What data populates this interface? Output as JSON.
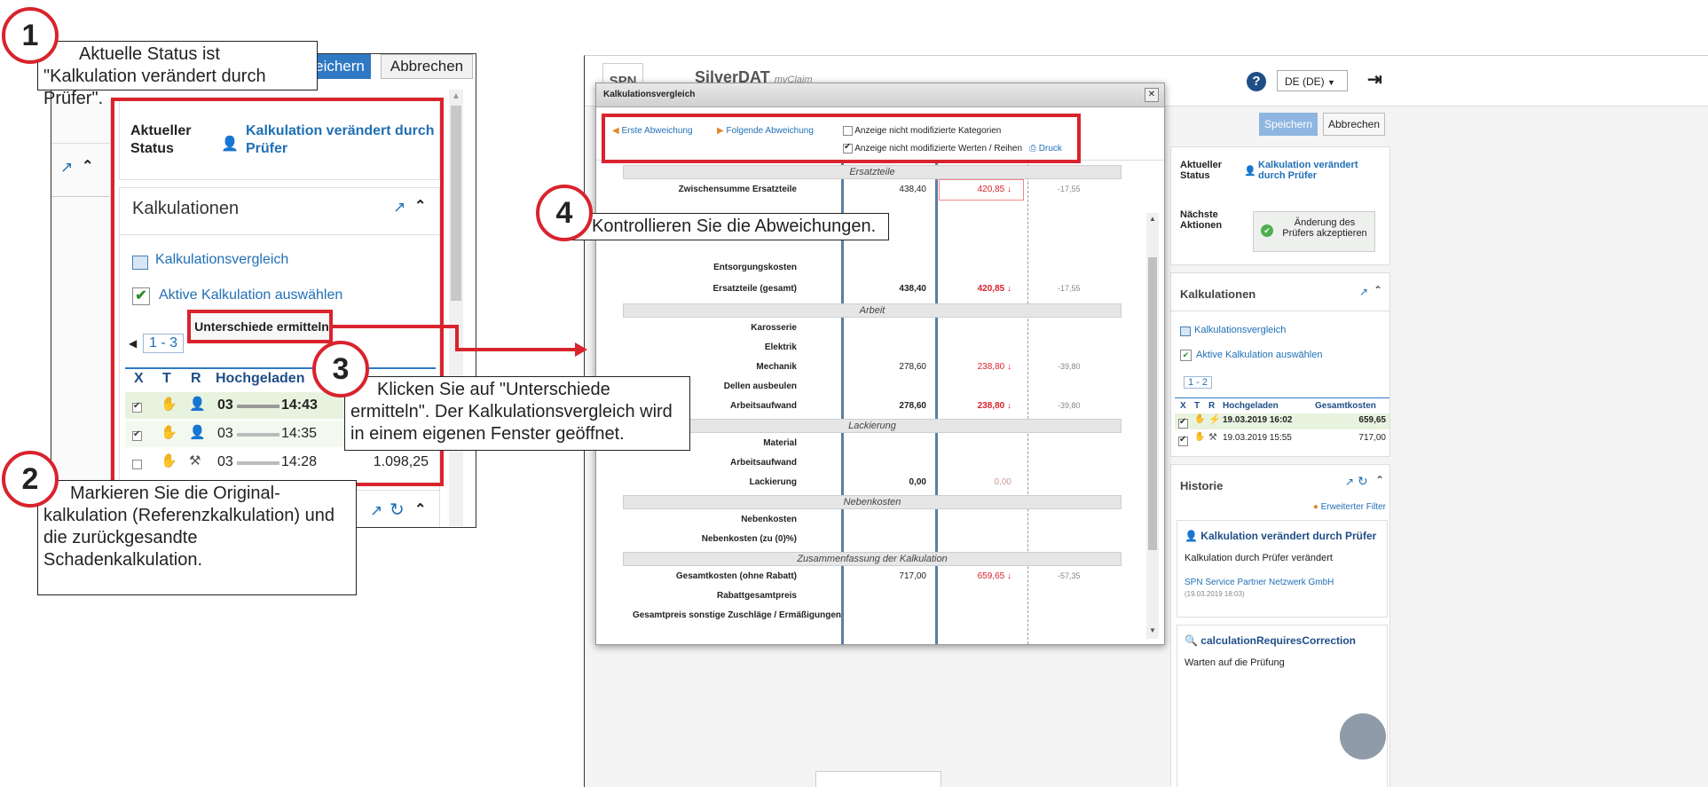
{
  "colors": {
    "accent_red": "#d9232d",
    "link_blue": "#1f6fb5",
    "highlight_green": "#e8f3df"
  },
  "left": {
    "buttons": {
      "save": "eichern",
      "cancel": "Abbrechen"
    },
    "status": {
      "label": "Aktueller Status",
      "value": "Kalkulation verändert durch Prüfer"
    },
    "calc_panel": {
      "title": "Kalkulationen",
      "link_compare": "Kalkulationsvergleich",
      "link_select": "Aktive Kalkulation auswählen",
      "diff_button": "Unterschiede ermitteln",
      "pager": "1 - 3",
      "columns": [
        "X",
        "T",
        "R",
        "Hochgeladen"
      ],
      "rows": [
        {
          "date": "03",
          "time": "14:43",
          "amount": ""
        },
        {
          "date": "03",
          "time": "14:35",
          "amount": ""
        },
        {
          "date": "03",
          "time": "14:28",
          "amount": "1.098,25"
        }
      ]
    }
  },
  "callouts": {
    "c1": {
      "num": "1",
      "text": "Aktuelle Status ist \"Kalkulation verändert durch Prüfer\"."
    },
    "c2": {
      "num": "2",
      "text": "Markieren Sie die Original-kalkulation (Referenzkalkulation) und die zurückgesandte Schadenkalkulation."
    },
    "c3": {
      "num": "3",
      "text": "Klicken Sie auf \"Unterschiede ermitteln\". Der Kalkulationsvergleich wird in einem eigenen Fenster geöffnet."
    },
    "c4": {
      "num": "4",
      "text": "Kontrollieren Sie die Abweichungen."
    }
  },
  "app": {
    "logo": "SPN",
    "title": "SilverDAT",
    "subtitle": "myClaim",
    "lang": "DE (DE)",
    "save": "Speichern",
    "cancel": "Abbrechen",
    "status_label": "Aktueller Status",
    "status_value": "Kalkulation verändert durch Prüfer",
    "next_label": "Nächste Aktionen",
    "accept_button": "Änderung des Prüfers akzeptieren",
    "calc_title": "Kalkulationen",
    "link_compare": "Kalkulationsvergleich",
    "link_select": "Aktive Kalkulation auswählen",
    "pager": "1 - 2",
    "columns": [
      "X",
      "T",
      "R",
      "Hochgeladen",
      "Gesamtkosten"
    ],
    "rows": [
      {
        "date": "19.03.2019 16:02",
        "cost": "659,65"
      },
      {
        "date": "19.03.2019 15:55",
        "cost": "717,00"
      }
    ],
    "hist_title": "Historie",
    "hist_filter": "Erweiterter Filter",
    "hist_item_title": "Kalkulation verändert durch Prüfer",
    "hist_item_text": "Kalkulation durch Prüfer verändert",
    "hist_item_org": "SPN Service Partner Netzwerk GmbH",
    "hist_item_date": "(19.03.2019 18:03)",
    "hist_item2_title": "calculationRequiresCorrection",
    "hist_item2_text": "Warten auf die Prüfung"
  },
  "modal": {
    "title": "Kalkulationsvergleich",
    "first_dev": "Erste Abweichung",
    "next_dev": "Folgende Abweichung",
    "opt1": "Anzeige nicht modifizierte Kategorien",
    "opt2": "Anzeige nicht modifizierte Werten / Reihen",
    "print": "Druck",
    "sections": [
      "Ersatzteile",
      "Arbeit",
      "Lackierung",
      "Nebenkosten",
      "Zusammenfassung der Kalkulation"
    ],
    "rows": [
      {
        "label": "Zwischensumme Ersatzteile",
        "a": "438,40",
        "b": "420,85",
        "d": "-17,55"
      },
      {
        "label": "Entsorgungskosten",
        "a": "",
        "b": "",
        "d": ""
      },
      {
        "label": "Ersatzteile (gesamt)",
        "a": "438,40",
        "b": "420,85",
        "d": "-17,55"
      },
      {
        "label": "Karosserie",
        "a": "",
        "b": "",
        "d": ""
      },
      {
        "label": "Elektrik",
        "a": "",
        "b": "",
        "d": ""
      },
      {
        "label": "Mechanik",
        "a": "278,60",
        "b": "238,80",
        "d": "-39,80"
      },
      {
        "label": "Dellen ausbeulen",
        "a": "",
        "b": "",
        "d": ""
      },
      {
        "label": "Arbeitsaufwand",
        "a": "278,60",
        "b": "238,80",
        "d": "-39,80"
      },
      {
        "label": "Material",
        "a": "",
        "b": "",
        "d": ""
      },
      {
        "label": "Arbeitsaufwand",
        "a": "",
        "b": "",
        "d": ""
      },
      {
        "label": "Lackierung",
        "a": "0,00",
        "b": "0,00",
        "d": ""
      },
      {
        "label": "Nebenkosten",
        "a": "",
        "b": "",
        "d": ""
      },
      {
        "label": "Nebenkosten (zu (0)%)",
        "a": "",
        "b": "",
        "d": ""
      },
      {
        "label": "Gesamtkosten (ohne Rabatt)",
        "a": "717,00",
        "b": "659,65",
        "d": "-57,35"
      },
      {
        "label": "Rabattgesamtpreis",
        "a": "",
        "b": "",
        "d": ""
      },
      {
        "label": "Gesamtpreis sonstige Zuschläge / Ermäßigungen",
        "a": "",
        "b": "",
        "d": ""
      }
    ]
  }
}
